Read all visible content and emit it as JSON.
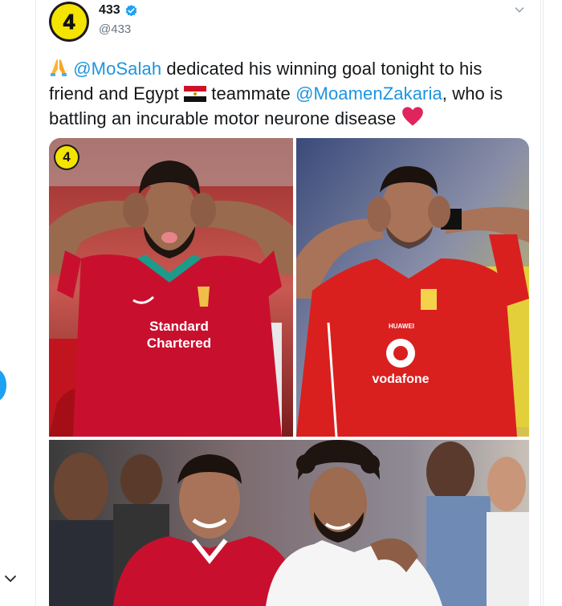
{
  "account": {
    "name": "433",
    "handle": "@433",
    "avatar_text": "4"
  },
  "tweet": {
    "mention_1": "@MoSalah",
    "text_1": " dedicated his winning goal tonight to his friend and Egypt ",
    "text_2": " teammate ",
    "mention_2": "@MoamenZakaria",
    "text_3": ", who is battling an incurable motor neurone disease "
  },
  "media": {
    "logo_text": "4",
    "shirt_1_line_1": "Standard",
    "shirt_1_line_2": "Chartered",
    "shirt_2_brand": "vodafone",
    "shirt_2_sponsor": "HUAWEI"
  },
  "colors": {
    "link": "#1b95e0",
    "verified": "#1da1f2",
    "heart": "#e0245e",
    "brand_yellow": "#f5e300"
  },
  "icons": [
    "verified-icon",
    "chevron-down-icon",
    "folded-hands-emoji",
    "egypt-flag-emoji",
    "red-heart-emoji"
  ]
}
